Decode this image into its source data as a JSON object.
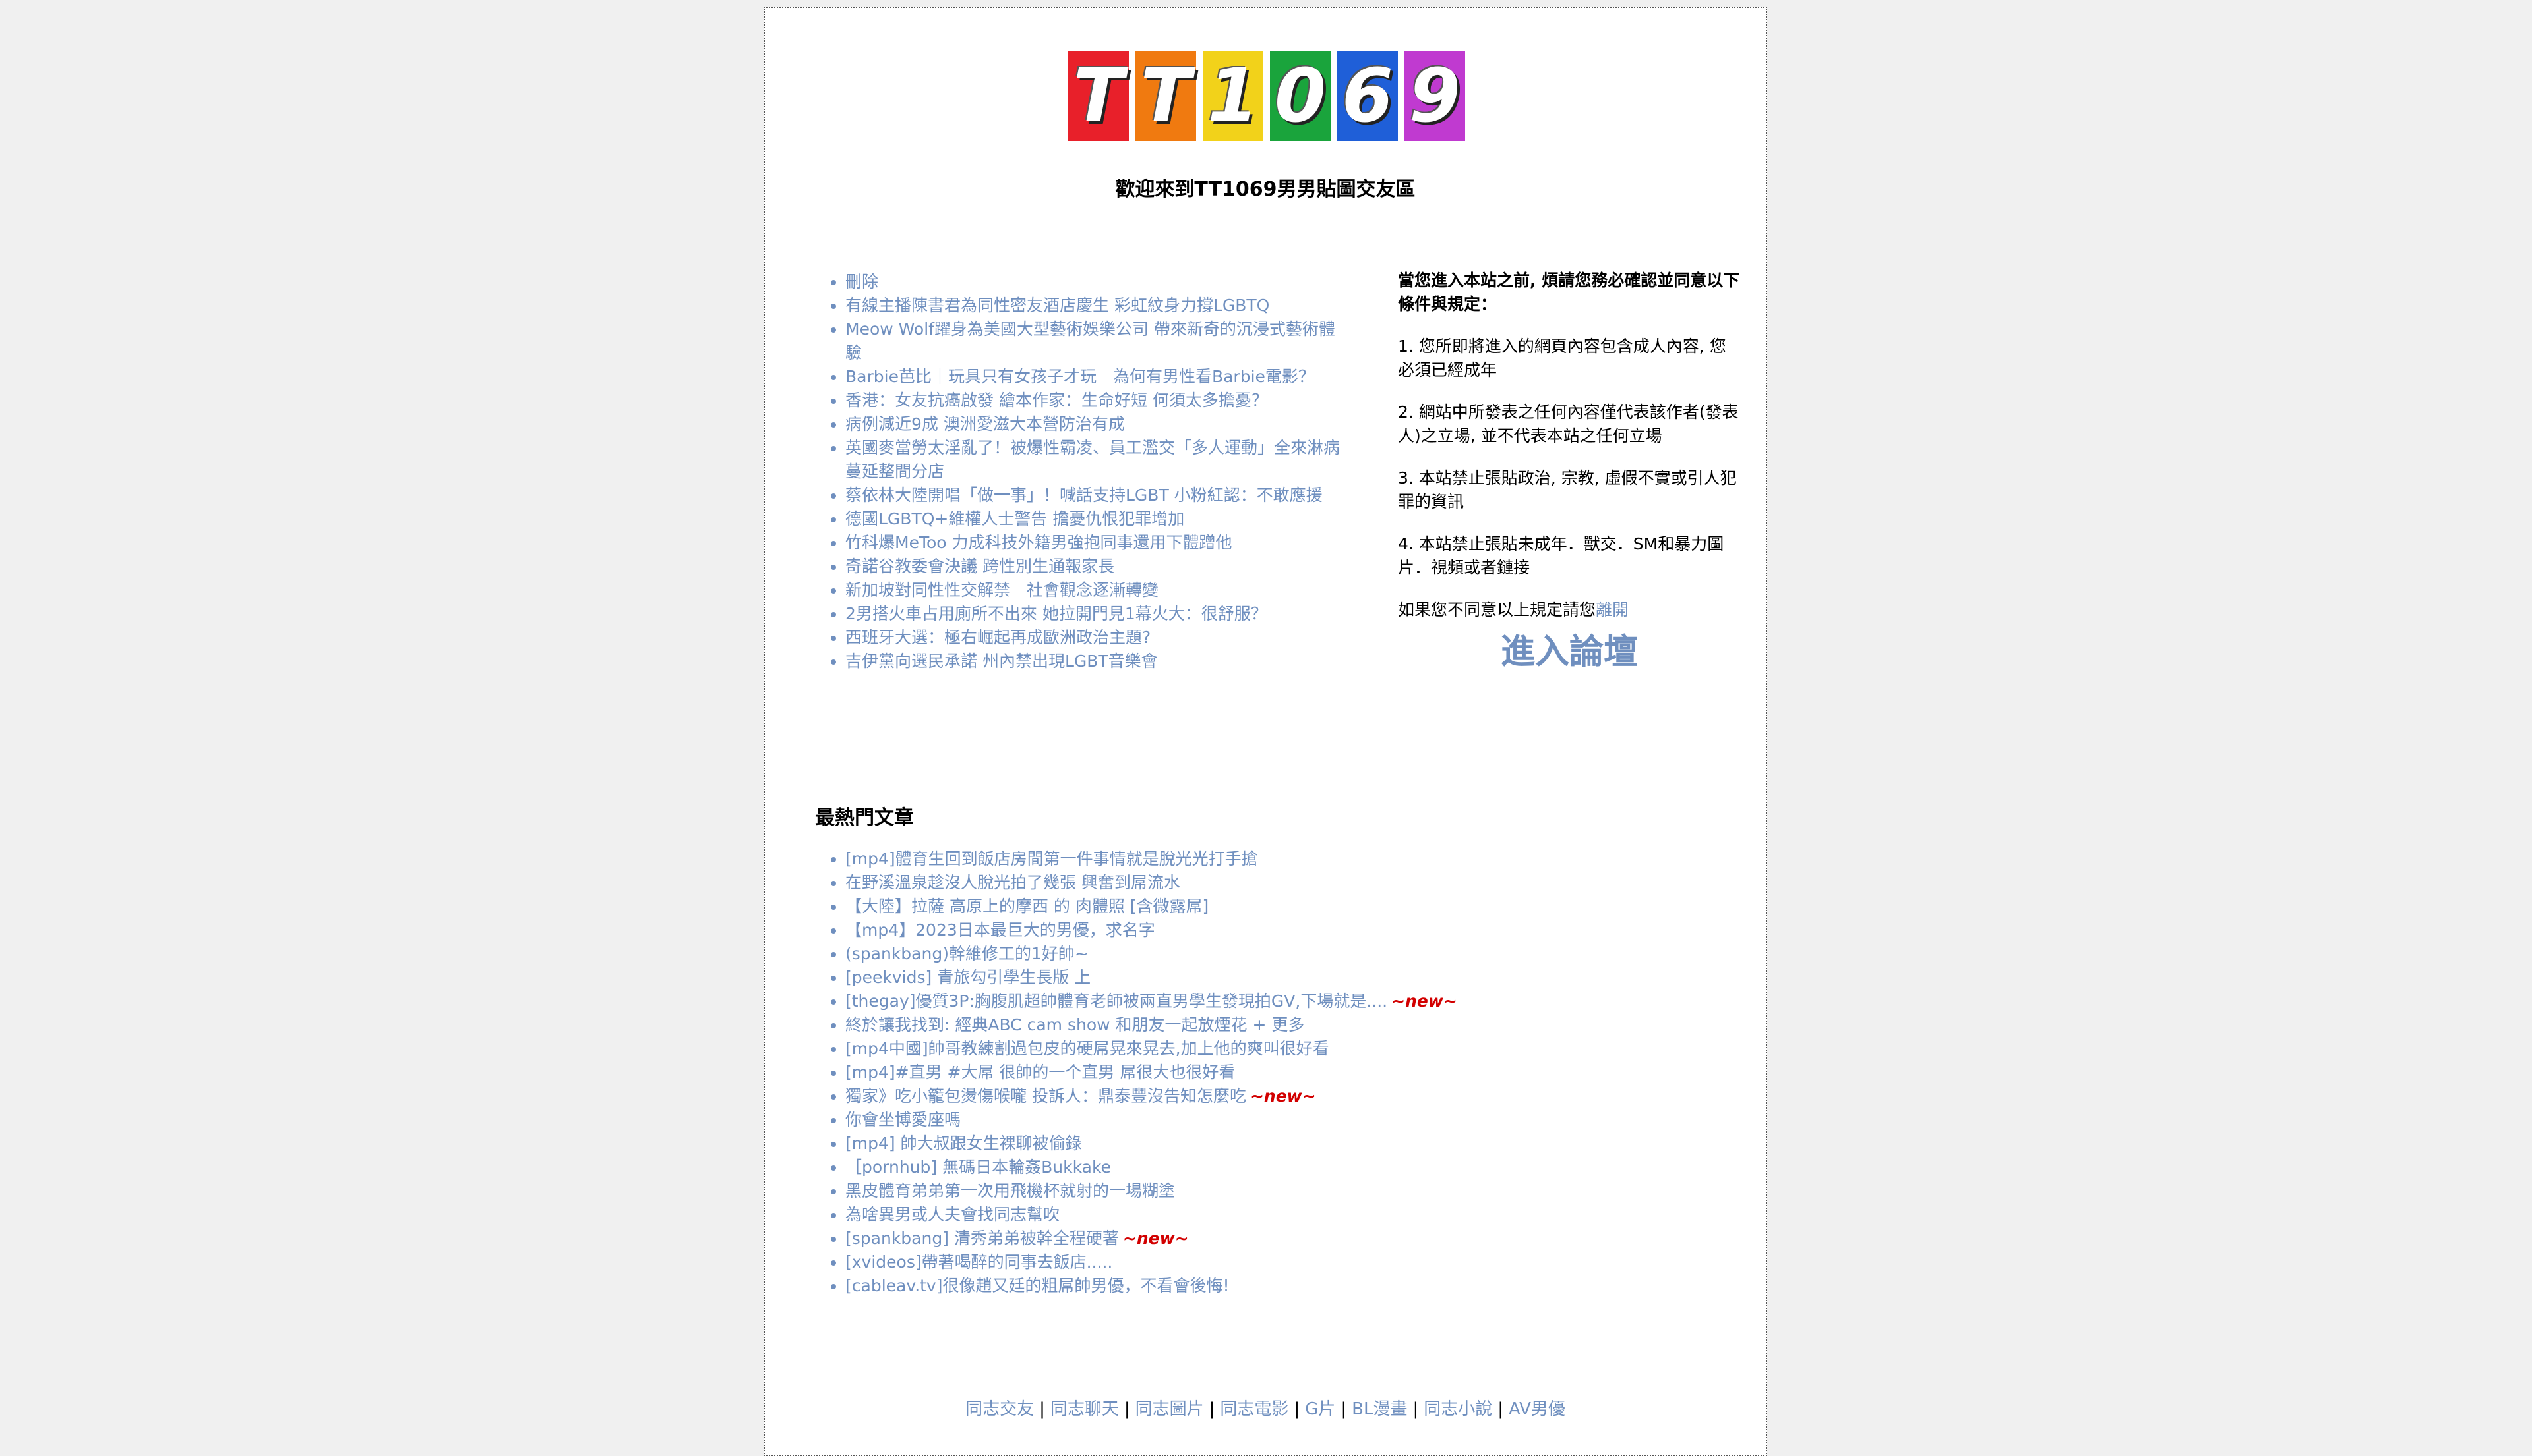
{
  "logo": {
    "tiles": [
      {
        "char": "T",
        "color": "#e8202a"
      },
      {
        "char": "T",
        "color": "#f07a10"
      },
      {
        "char": "1",
        "color": "#f2d21a"
      },
      {
        "char": "0",
        "color": "#1aa43c"
      },
      {
        "char": "6",
        "color": "#1f5fd8"
      },
      {
        "char": "9",
        "color": "#c03ad0"
      }
    ]
  },
  "welcome": "歡迎來到TT1069男男貼圖交友區",
  "news": [
    "刪除",
    "有線主播陳書君為同性密友酒店慶生 彩虹紋身力撐LGBTQ",
    "Meow Wolf躍身為美國大型藝術娛樂公司 帶來新奇的沉浸式藝術體驗",
    "Barbie芭比｜玩具只有女孩子才玩　為何有男性看Barbie電影？",
    "香港：女友抗癌啟發 繪本作家：生命好短 何須太多擔憂？",
    "病例減近9成 澳洲愛滋大本營防治有成",
    "英國麥當勞太淫亂了！被爆性霸凌、員工濫交「多人運動」全來淋病蔓延整間分店",
    "蔡依林大陸開唱「做一事」！喊話支持LGBT 小粉紅認：不敢應援",
    "德國LGBTQ+維權人士警告 擔憂仇恨犯罪增加",
    "竹科爆MeToo 力成科技外籍男強抱同事還用下體蹭他",
    "奇諾谷教委會決議 跨性別生通報家長",
    "新加坡對同性性交解禁　社會觀念逐漸轉變",
    "2男搭火車占用廁所不出來 她拉開門見1幕火大：很舒服？",
    "西班牙大選：極右崛起再成歐洲政治主題?",
    "吉伊黨向選民承諾 州內禁出現LGBT音樂會"
  ],
  "rules": {
    "heading": "當您進入本站之前, 煩請您務必確認並同意以下條件與規定：",
    "items": [
      "1. 您所即將進入的網頁內容包含成人內容, 您必須已經成年",
      "2. 網站中所發表之任何內容僅代表該作者(發表人)之立場, 並不代表本站之任何立場",
      "3. 本站禁止張貼政治, 宗教, 虛假不實或引人犯罪的資訊",
      "4. 本站禁止張貼未成年．獸交．SM和暴力圖片．視頻或者鏈接"
    ],
    "disagree_text": "如果您不同意以上規定請您",
    "leave_link": "離開",
    "enter_button": "進入論壇"
  },
  "hot": {
    "title": "最熱門文章",
    "new_label": "~new~",
    "items": [
      {
        "text": "[mp4]體育生回到飯店房間第一件事情就是脫光光打手搶",
        "new": false
      },
      {
        "text": "在野溪溫泉趁沒人脫光拍了幾張 興奮到屌流水",
        "new": false
      },
      {
        "text": "【大陸】拉薩 高原上的摩西 的 肉體照 [含微露屌]",
        "new": false
      },
      {
        "text": "【mp4】2023日本最巨大的男優，求名字",
        "new": false
      },
      {
        "text": "(spankbang)幹維修工的1好帥~",
        "new": false
      },
      {
        "text": "[peekvids] 青旅勾引學生長版 上",
        "new": false
      },
      {
        "text": "[thegay]優質3P:胸腹肌超帥體育老師被兩直男學生發現拍GV,下場就是....",
        "new": true
      },
      {
        "text": "終於讓我找到: 經典ABC cam show 和朋友一起放煙花 + 更多",
        "new": false
      },
      {
        "text": "[mp4中國]帥哥教練割過包皮的硬屌晃來晃去,加上他的爽叫很好看",
        "new": false
      },
      {
        "text": "[mp4]#直男 #大屌 很帥的一个直男 屌很大也很好看",
        "new": false
      },
      {
        "text": "獨家》吃小籠包燙傷喉嚨 投訴人：鼎泰豐沒告知怎麼吃",
        "new": true
      },
      {
        "text": "你會坐博愛座嗎",
        "new": false
      },
      {
        "text": "[mp4] 帥大叔跟女生裸聊被偷錄",
        "new": false
      },
      {
        "text": "［pornhub] 無碼日本輪姦Bukkake",
        "new": false
      },
      {
        "text": "黑皮體育弟弟第一次用飛機杯就射的一場糊塗",
        "new": false
      },
      {
        "text": "為啥異男或人夫會找同志幫吹",
        "new": false
      },
      {
        "text": "[spankbang] 清秀弟弟被幹全程硬著",
        "new": true
      },
      {
        "text": "[xvideos]帶著喝醉的同事去飯店.....",
        "new": false
      },
      {
        "text": "[cableav.tv]很像趙又廷的粗屌帥男優，不看會後悔!",
        "new": false
      }
    ]
  },
  "footer": {
    "links": [
      "同志交友",
      "同志聊天",
      "同志圖片",
      "同志電影",
      "G片",
      "BL漫畫",
      "同志小說",
      "AV男優"
    ],
    "separator": "|"
  }
}
